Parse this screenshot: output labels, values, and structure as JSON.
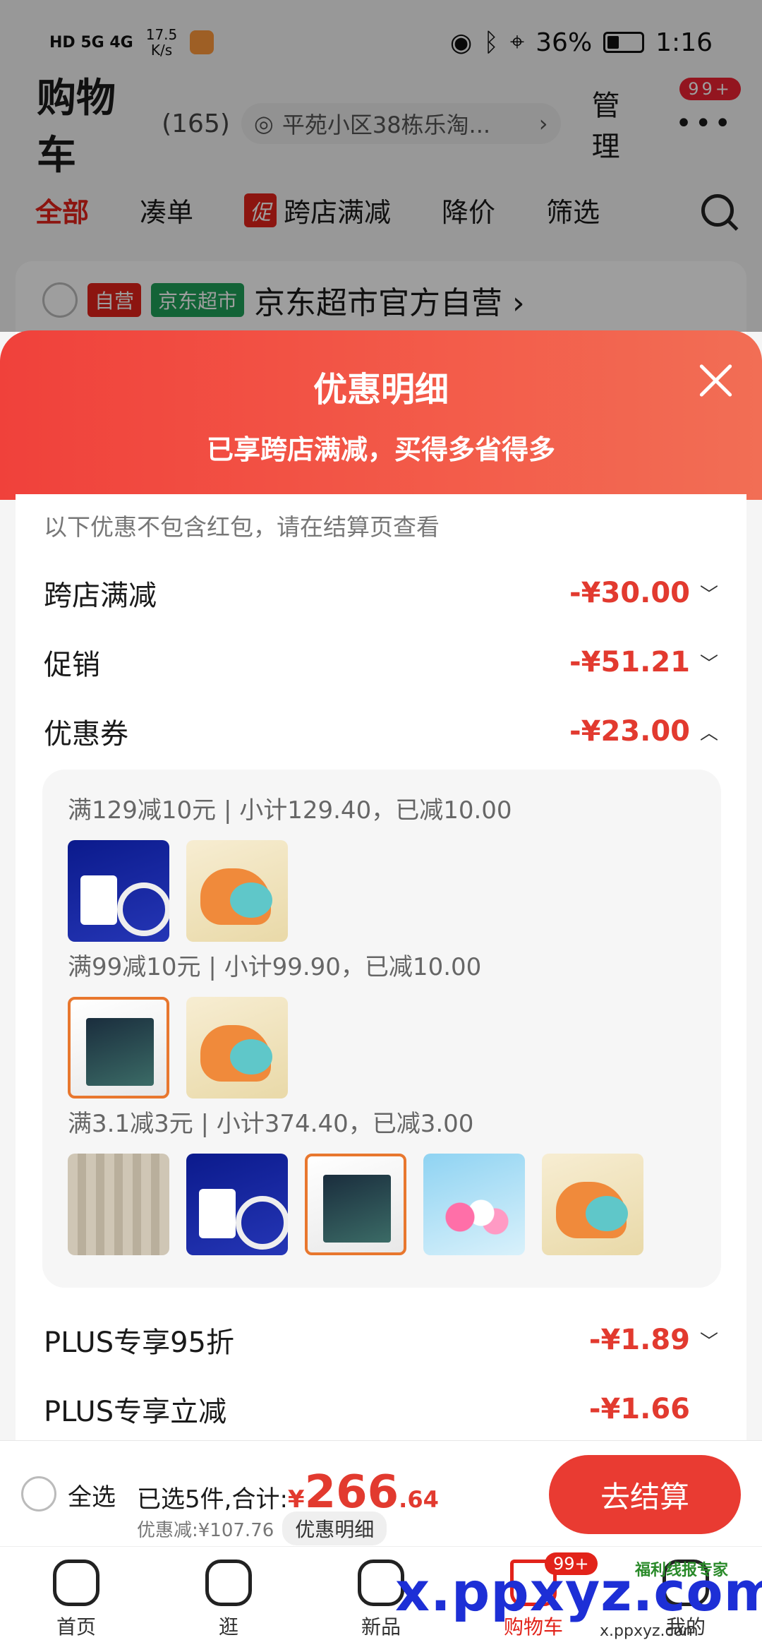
{
  "status": {
    "signal": "HD 5G 4G",
    "speed": "17.5\nK/s",
    "battery": "36%",
    "time": "1:16"
  },
  "header": {
    "title": "购物车",
    "count": "(165)",
    "address": "平苑小区38栋乐淘...",
    "manage": "管理",
    "badge": "99+"
  },
  "tabs": [
    {
      "label": "全部",
      "active": true
    },
    {
      "label": "凑单"
    },
    {
      "label": "跨店满减",
      "tag": "促"
    },
    {
      "label": "降价"
    },
    {
      "label": "筛选"
    }
  ],
  "store": {
    "tag1": "自营",
    "tag2": "京东超市",
    "name": "京东超市官方自营 ›"
  },
  "sheet": {
    "title": "优惠明细",
    "subtitle": "已享跨店满减，买得多省得多",
    "note": "以下优惠不包含红包，请在结算页查看",
    "rows": [
      {
        "label": "跨店满减",
        "amount": "-¥30.00",
        "chevron": "﹀"
      },
      {
        "label": "促销",
        "amount": "-¥51.21",
        "chevron": "﹀"
      },
      {
        "label": "优惠券",
        "amount": "-¥23.00",
        "chevron": "︿"
      }
    ],
    "coupons": [
      {
        "title": "满129减10元 | 小计129.40，已减10.00",
        "items": [
          "realme-charger",
          "dino-toy"
        ]
      },
      {
        "title": "满99减10元 | 小计99.90，已减10.00",
        "items": [
          "lego-brickheadz",
          "dino-toy"
        ]
      },
      {
        "title": "满3.1减3元 | 小计374.40，已减3.00",
        "items": [
          "curtain-rod",
          "realme-charger",
          "lego-brickheadz",
          "water-balloons",
          "dino-toy"
        ]
      }
    ],
    "plus_rows": [
      {
        "label": "PLUS专享95折",
        "amount": "-¥1.89",
        "chevron": "﹀"
      },
      {
        "label": "PLUS专享立减",
        "amount": "-¥1.66"
      }
    ]
  },
  "checkout": {
    "select_all": "全选",
    "prefix": "已选5件,合计:",
    "yen": "¥",
    "total_int": "266",
    "total_dec": ".64",
    "discount": "优惠减:¥107.76",
    "detail_btn": "优惠明细",
    "go": "去结算"
  },
  "tabbar": [
    {
      "label": "首页"
    },
    {
      "label": "逛"
    },
    {
      "label": "新品"
    },
    {
      "label": "购物车",
      "active": true,
      "badge": "99+"
    },
    {
      "label": "我的"
    }
  ],
  "watermark": {
    "text": "x.ppxyz.com",
    "sub": "x.ppxyz.com",
    "logo": "福利线报专家"
  }
}
